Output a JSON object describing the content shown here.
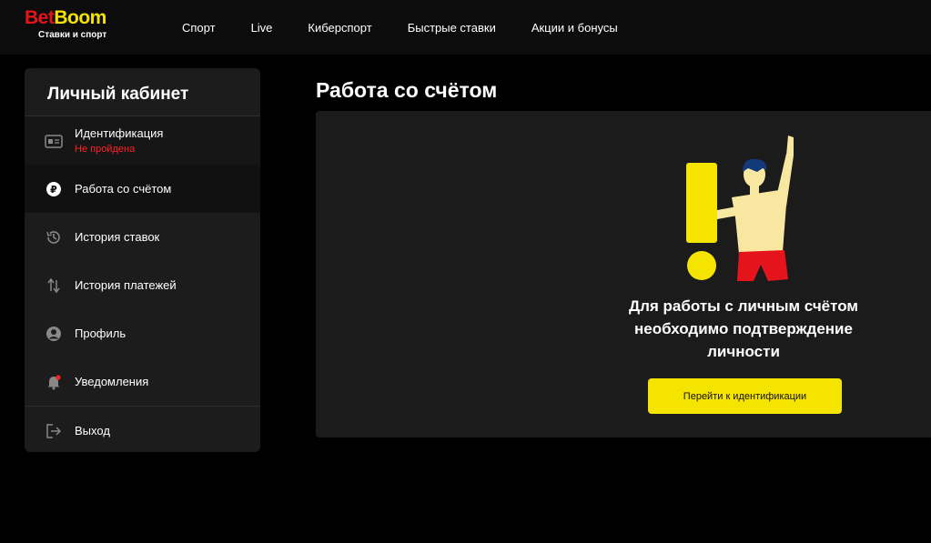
{
  "header": {
    "logo": {
      "bet": "Bet",
      "boom": "Boom",
      "tagline": "Ставки и спорт"
    },
    "nav": [
      "Спорт",
      "Live",
      "Киберспорт",
      "Быстрые ставки",
      "Акции и бонусы"
    ]
  },
  "sidebar": {
    "title": "Личный кабинет",
    "identification": {
      "label": "Идентификация",
      "status": "Не пройдена"
    },
    "items": {
      "account": "Работа со счётом",
      "bet_history": "История ставок",
      "payment_history": "История платежей",
      "profile": "Профиль",
      "notifications": "Уведомления",
      "logout": "Выход"
    }
  },
  "main": {
    "title": "Работа со счётом",
    "message": "Для работы с личным счётом необходимо подтверждение личности",
    "cta_label": "Перейти к идентификации"
  },
  "colors": {
    "accent": "#f5e400",
    "brand_red": "#e5141c",
    "error": "#ff2020",
    "background": "#000000"
  }
}
